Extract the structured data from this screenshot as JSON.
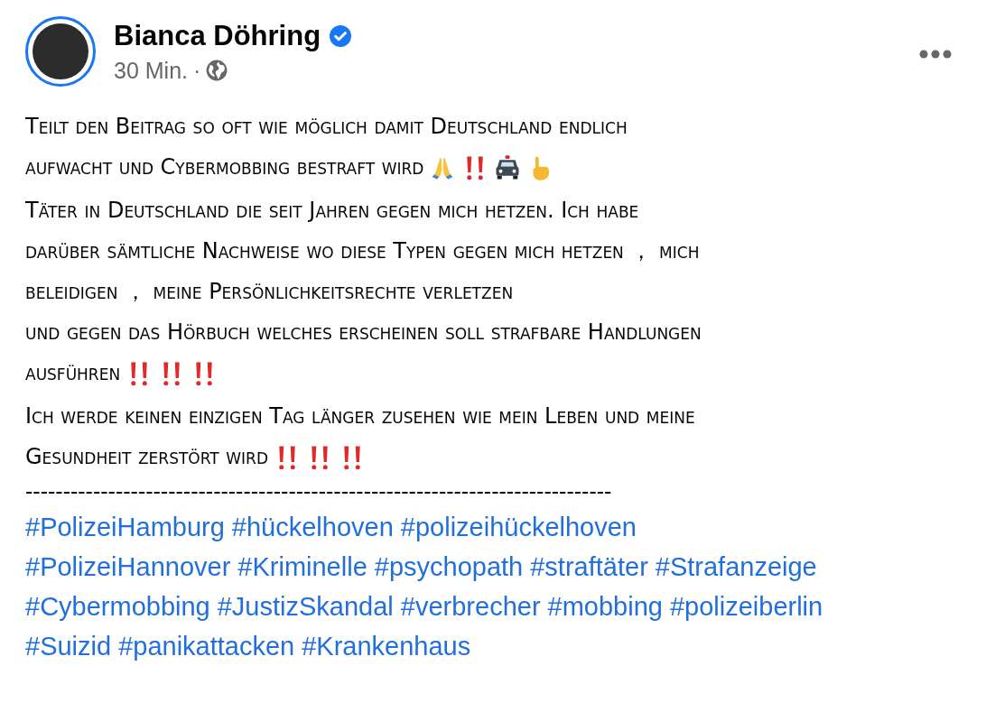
{
  "post": {
    "author": "Bianca Döhring",
    "verified": true,
    "time": "30 Min.",
    "separator": "·",
    "paragraphs": [
      {
        "lines": [
          "Teilt den Beitrag so oft wie möglich damit Deutschland endlich",
          "aufwacht und Cybermobbing bestraft wird"
        ],
        "emojis": [
          {
            "kind": "pray"
          },
          {
            "kind": "bangbang"
          },
          {
            "kind": "police_car"
          },
          {
            "kind": "point_up"
          }
        ]
      },
      {
        "lines": [
          "Täter in Deutschland die seit Jahren gegen mich hetzen. Ich habe",
          "darüber sämtliche Nachweise wo diese Typen gegen mich hetzen ， mich",
          "beleidigen ， meine Persönlichkeitsrechte verletzen",
          "und gegen das Hörbuch welches erscheinen soll strafbare Handlungen",
          "ausführen"
        ],
        "emojis": [
          {
            "kind": "bangbang"
          },
          {
            "kind": "bangbang"
          },
          {
            "kind": "bangbang"
          }
        ]
      },
      {
        "lines": [
          "Ich werde keinen einzigen Tag länger zusehen wie mein Leben und meine",
          "Gesundheit zerstört wird"
        ],
        "emojis": [
          {
            "kind": "bangbang"
          },
          {
            "kind": "bangbang"
          },
          {
            "kind": "bangbang"
          }
        ]
      }
    ],
    "divider": "------------------------------------------------------------------------------",
    "hashtag_lines": [
      [
        "#PolizeiHamburg",
        "#hückelhoven",
        "#polizeihückelhoven"
      ],
      [
        "#PolizeiHannover",
        "#Kriminelle",
        "#psychopath",
        "#straftäter",
        "#Strafanzeige"
      ],
      [
        "#Cybermobbing",
        "#JustizSkandal",
        "#verbrecher",
        "#mobbing",
        "#polizeiberlin"
      ],
      [
        "#Suizid",
        "#panikattacken",
        "#Krankenhaus"
      ]
    ]
  }
}
